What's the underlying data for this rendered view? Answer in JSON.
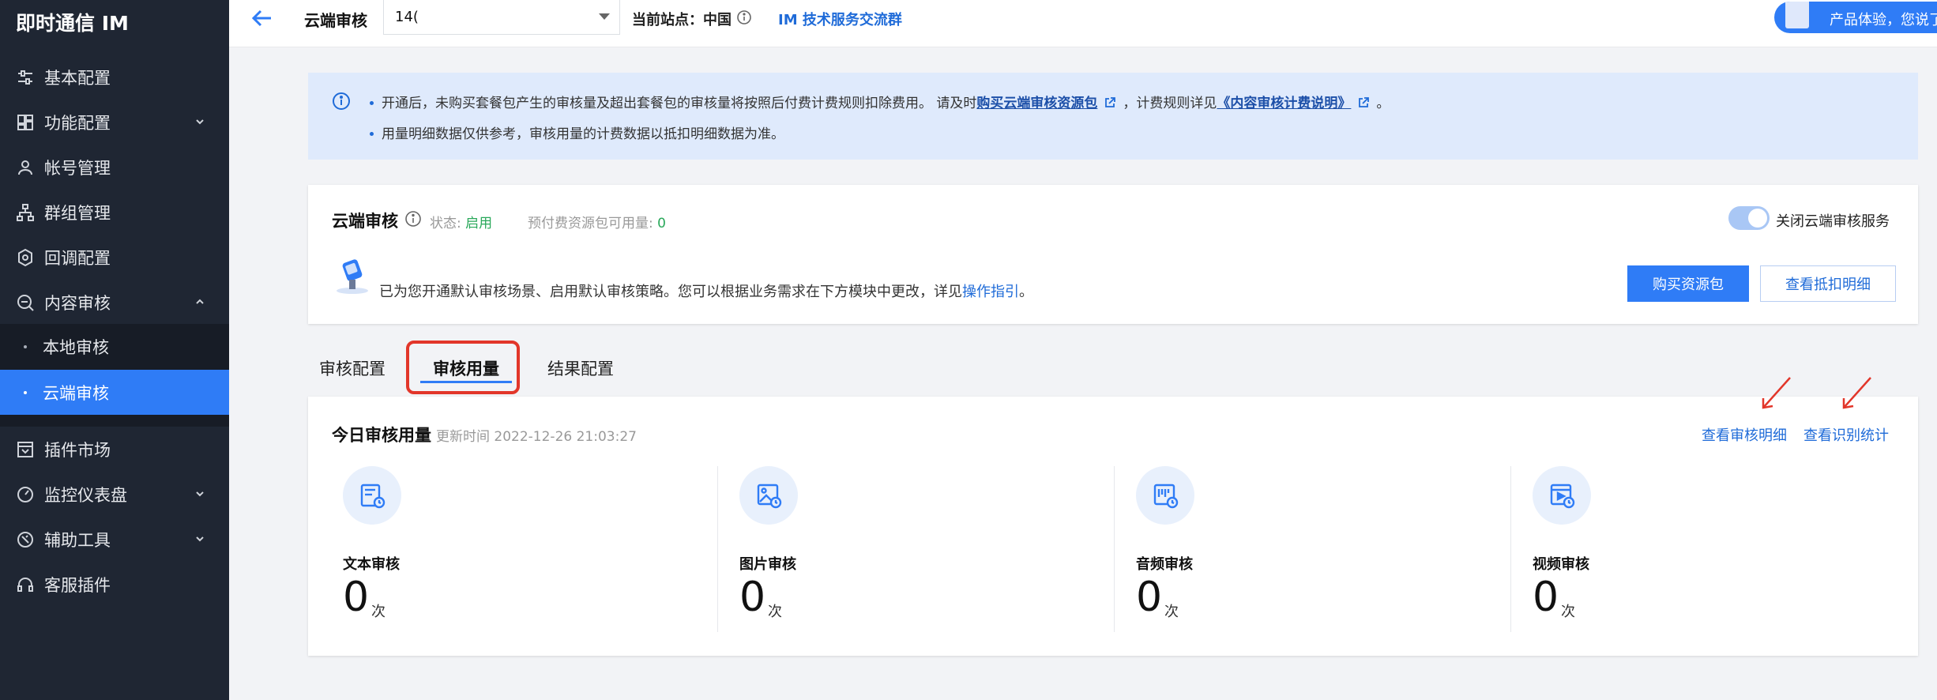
{
  "sidebar": {
    "brand": "即时通信 IM",
    "items": [
      {
        "label": "基本配置"
      },
      {
        "label": "功能配置"
      },
      {
        "label": "帐号管理"
      },
      {
        "label": "群组管理"
      },
      {
        "label": "回调配置"
      },
      {
        "label": "内容审核"
      },
      {
        "label": "本地审核"
      },
      {
        "label": "云端审核"
      },
      {
        "label": "插件市场"
      },
      {
        "label": "监控仪表盘"
      },
      {
        "label": "辅助工具"
      },
      {
        "label": "客服插件"
      }
    ]
  },
  "topbar": {
    "title": "云端审核",
    "app_select_value": "14(",
    "site_label": "当前站点：中国",
    "tech_link": "IM 技术服务交流群",
    "feedback": "产品体验，您说了"
  },
  "notice": {
    "line1_a": "开通后，未购买套餐包产生的审核量及超出套餐包的审核量将按照后付费计费规则扣除费用。 请及时",
    "line1_link1": "购买云端审核资源包",
    "line1_b": "，计费规则详见",
    "line1_link2": "《内容审核计费说明》",
    "line1_c": "。",
    "line2": "用量明细数据仅供参考，审核用量的计费数据以抵扣明细数据为准。"
  },
  "status_card": {
    "title": "云端审核",
    "status_label": "状态: ",
    "status_value": "启用",
    "prepaid_label": "预付费资源包可用量: ",
    "prepaid_value": "0",
    "toggle_label": "关闭云端审核服务",
    "desc": "已为您开通默认审核场景、启用默认审核策略。您可以根据业务需求在下方模块中更改，详见",
    "desc_link": "操作指引",
    "desc_end": "。",
    "buy_button": "购买资源包",
    "detail_button": "查看抵扣明细"
  },
  "tabs": [
    {
      "label": "审核配置"
    },
    {
      "label": "审核用量"
    },
    {
      "label": "结果配置"
    }
  ],
  "usage": {
    "title": "今日审核用量",
    "updated": "更新时间 2022-12-26 21:03:27",
    "link_detail": "查看审核明细",
    "link_stats": "查看识别统计",
    "metrics": [
      {
        "label": "文本审核",
        "value": "0",
        "unit": "次",
        "icon": "text-audit-icon"
      },
      {
        "label": "图片审核",
        "value": "0",
        "unit": "次",
        "icon": "image-audit-icon"
      },
      {
        "label": "音频审核",
        "value": "0",
        "unit": "次",
        "icon": "audio-audit-icon"
      },
      {
        "label": "视频审核",
        "value": "0",
        "unit": "次",
        "icon": "video-audit-icon"
      }
    ]
  },
  "colors": {
    "sidebar_bg": "#1f2633",
    "accent": "#2f7cf6",
    "link": "#1f6bd8",
    "success": "#29a85a",
    "highlight_red": "#e2362a"
  }
}
